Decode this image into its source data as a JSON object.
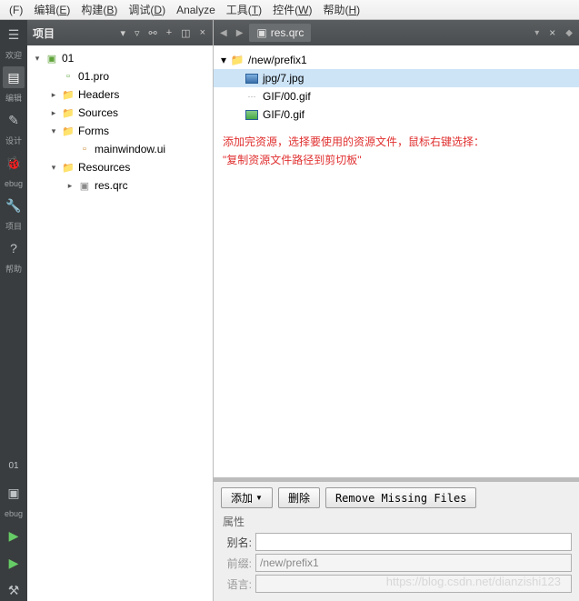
{
  "menubar": [
    {
      "label": "(F)",
      "key": ""
    },
    {
      "label": "编辑",
      "key": "E"
    },
    {
      "label": "构建",
      "key": "B"
    },
    {
      "label": "调试",
      "key": "D"
    },
    {
      "label": "Analyze",
      "key": ""
    },
    {
      "label": "工具",
      "key": "T"
    },
    {
      "label": "控件",
      "key": "W"
    },
    {
      "label": "帮助",
      "key": "H"
    }
  ],
  "left_rail": [
    {
      "icon": "☰",
      "label": "欢迎"
    },
    {
      "icon": "▤",
      "label": "编辑",
      "active": true
    },
    {
      "icon": "✎",
      "label": "设计"
    },
    {
      "icon": "🐞",
      "label": "ebug"
    },
    {
      "icon": "🔧",
      "label": "项目"
    },
    {
      "icon": "?",
      "label": "帮助"
    },
    {
      "icon": "",
      "label": ""
    },
    {
      "icon": "01",
      "label": ""
    },
    {
      "icon": "▣",
      "label": "ebug"
    },
    {
      "icon": "▶",
      "label": ""
    },
    {
      "icon": "▶",
      "label": ""
    },
    {
      "icon": "⚒",
      "label": ""
    }
  ],
  "project_panel": {
    "title": "项目",
    "tree": [
      {
        "depth": 0,
        "chev": "▾",
        "icon": "green",
        "glyph": "▣",
        "label": "01"
      },
      {
        "depth": 1,
        "chev": "",
        "icon": "green",
        "glyph": "▫",
        "label": "01.pro"
      },
      {
        "depth": 1,
        "chev": "▸",
        "icon": "folder",
        "glyph": "📁",
        "label": "Headers"
      },
      {
        "depth": 1,
        "chev": "▸",
        "icon": "folder",
        "glyph": "📁",
        "label": "Sources"
      },
      {
        "depth": 1,
        "chev": "▾",
        "icon": "folder",
        "glyph": "📁",
        "label": "Forms"
      },
      {
        "depth": 2,
        "chev": "",
        "icon": "uif",
        "glyph": "▫",
        "label": "mainwindow.ui"
      },
      {
        "depth": 1,
        "chev": "▾",
        "icon": "folder",
        "glyph": "📁",
        "label": "Resources"
      },
      {
        "depth": 2,
        "chev": "▸",
        "icon": "qrc",
        "glyph": "▣",
        "label": "res.qrc"
      }
    ]
  },
  "editor": {
    "tab_icon": "▣",
    "tab_label": "res.qrc",
    "resource_tree": [
      {
        "depth": 0,
        "chev": "▾",
        "type": "folder",
        "label": "/new/prefix1"
      },
      {
        "depth": 1,
        "chev": "",
        "type": "img",
        "label": "jpg/7.jpg",
        "selected": true
      },
      {
        "depth": 1,
        "chev": "",
        "type": "gif-d",
        "label": "GIF/00.gif"
      },
      {
        "depth": 1,
        "chev": "",
        "type": "gif",
        "label": "GIF/0.gif"
      }
    ],
    "annotation_line1": "添加完资源，选择要使用的资源文件，鼠标右键选择：",
    "annotation_line2": "\"复制资源文件路径到剪切板\""
  },
  "bottom": {
    "btn_add": "添加",
    "btn_delete": "删除",
    "btn_remove_missing": "Remove Missing Files",
    "section_label": "属性",
    "alias_label": "别名:",
    "alias_value": "",
    "prefix_label": "前缀:",
    "prefix_value": "/new/prefix1",
    "lang_label": "语言:",
    "lang_value": ""
  },
  "watermark": "https://blog.csdn.net/dianzishi123"
}
